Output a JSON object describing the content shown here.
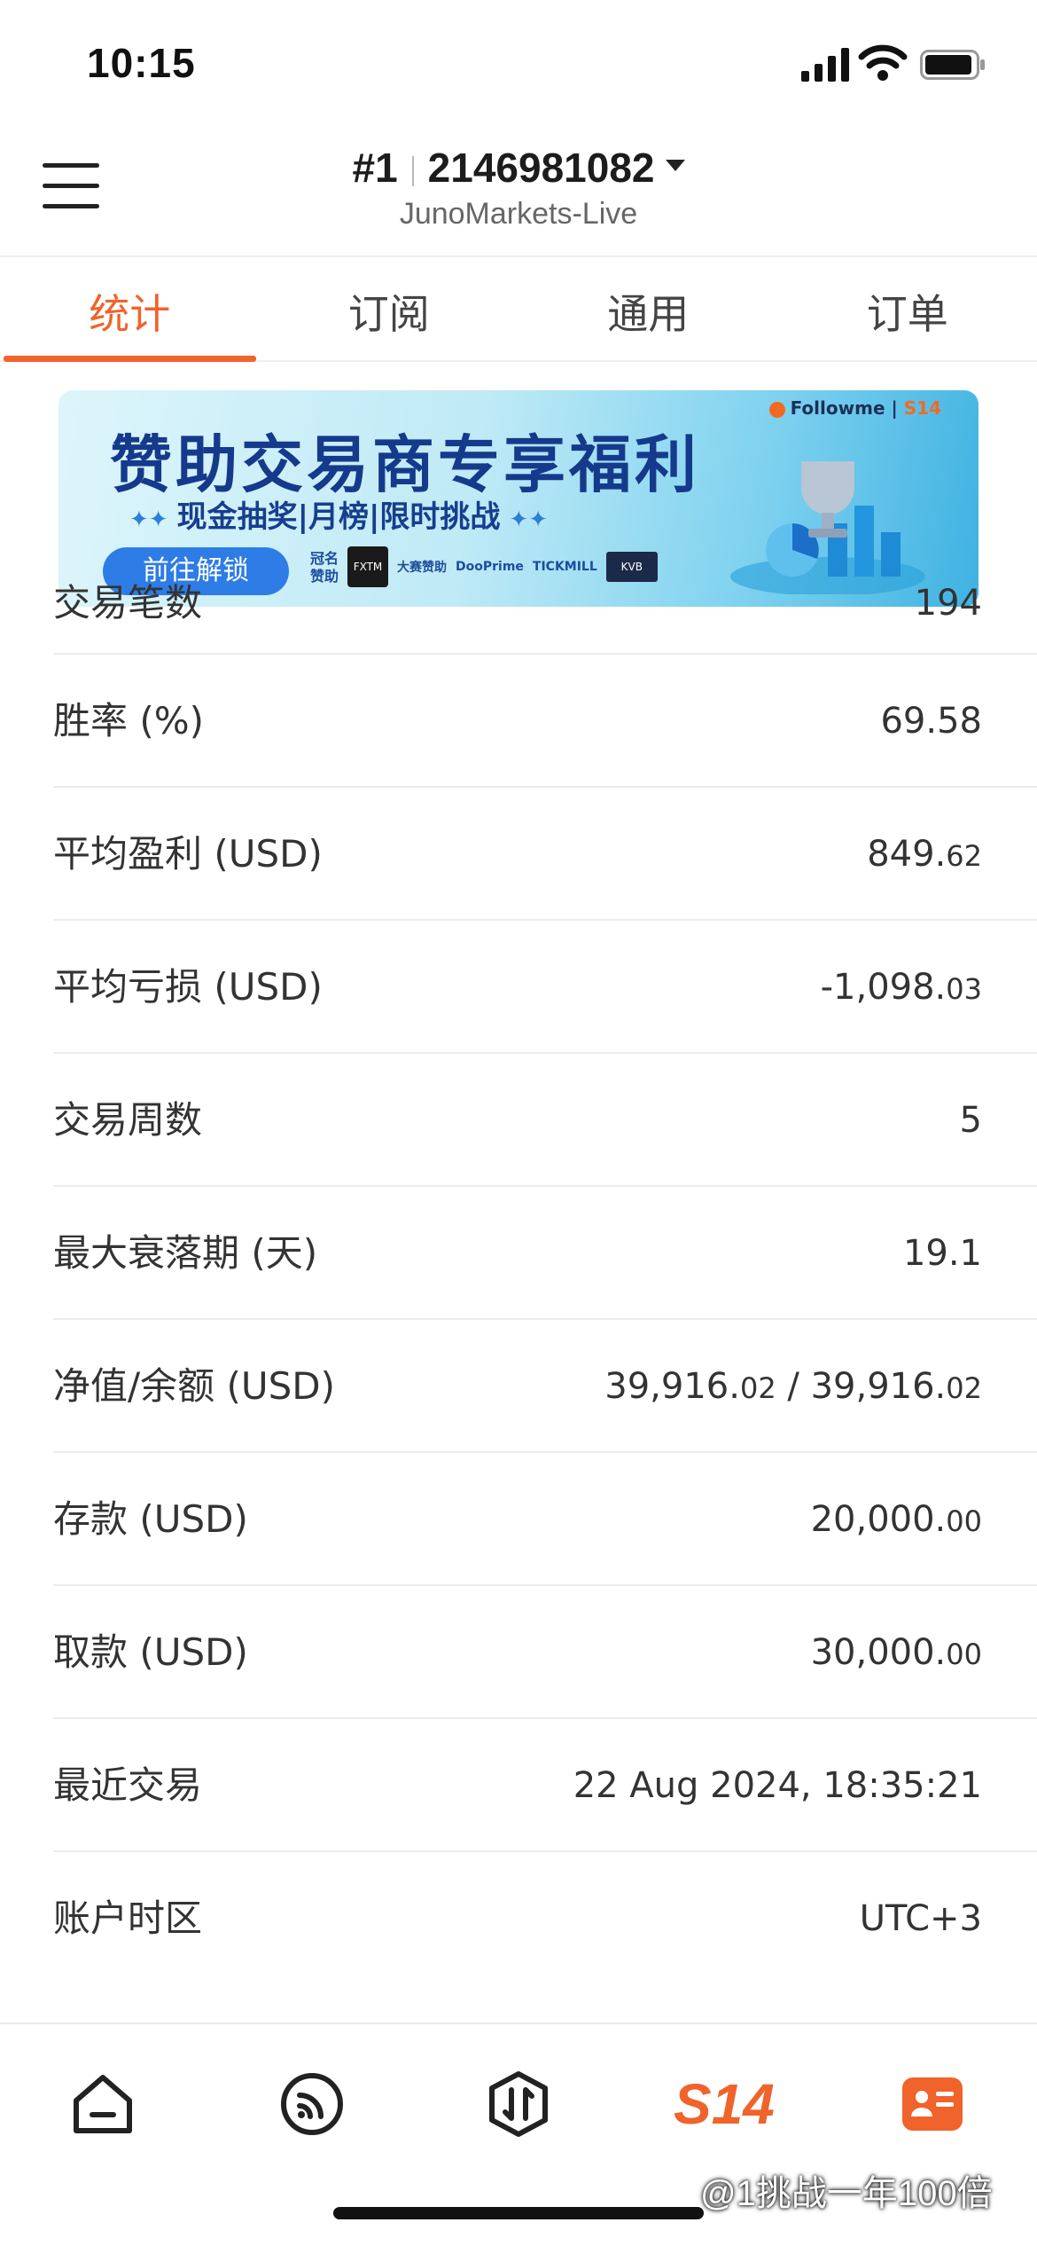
{
  "status": {
    "time": "10:15"
  },
  "header": {
    "account_no": "#1",
    "account_id": "2146981082",
    "server": "JunoMarkets-Live"
  },
  "tabs": [
    {
      "label": "统计",
      "active": true
    },
    {
      "label": "订阅",
      "active": false
    },
    {
      "label": "通用",
      "active": false
    },
    {
      "label": "订单",
      "active": false
    }
  ],
  "banner": {
    "brand": "Followme",
    "brand_tag": "S14",
    "title": "赞助交易商专享福利",
    "subtitle": "现金抽奖|月榜|限时挑战",
    "button": "前往解锁",
    "sponsor_label_1": "冠名",
    "sponsor_label_2": "赞助",
    "sponsor_logo": "FXTM",
    "sponsor_text": "大赛赞助",
    "partner_1": "DooPrime",
    "partner_2": "TICKMILL",
    "partner_3": "KVB"
  },
  "stats": [
    {
      "label": "交易笔数",
      "value": "194"
    },
    {
      "label": "胜率 (%)",
      "value": "69.58"
    },
    {
      "label": "平均盈利 (USD)",
      "value": "849.",
      "value_small": "62"
    },
    {
      "label": "平均亏损 (USD)",
      "value": "-1,098.",
      "value_small": "03"
    },
    {
      "label": "交易周数",
      "value": "5"
    },
    {
      "label": "最大衰落期 (天)",
      "value": "19.1"
    },
    {
      "label": "净值/余额 (USD)",
      "value": "39,916.",
      "value_small": "02",
      "value2": " / 39,916.",
      "value2_small": "02"
    },
    {
      "label": "存款 (USD)",
      "value": "20,000.",
      "value_small": "00"
    },
    {
      "label": "取款 (USD)",
      "value": "30,000.",
      "value_small": "00"
    },
    {
      "label": "最近交易",
      "value": "22 Aug 2024, 18:35:21"
    },
    {
      "label": "账户时区",
      "value": "UTC+3"
    }
  ],
  "bottom_nav": {
    "items": [
      "home-icon",
      "feed-icon",
      "trade-icon",
      "s14-icon",
      "profile-icon"
    ],
    "s14_label": "S14",
    "active_color": "#f0632a"
  },
  "watermark": "@1挑战一年100倍"
}
